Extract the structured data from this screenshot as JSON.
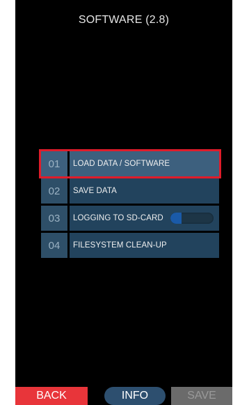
{
  "header": {
    "title": "SOFTWARE (2.8)"
  },
  "menu": {
    "items": [
      {
        "number": "01",
        "label": "LOAD DATA / SOFTWARE",
        "selected": true
      },
      {
        "number": "02",
        "label": "SAVE DATA"
      },
      {
        "number": "03",
        "label": "LOGGING TO SD-CARD",
        "toggle_level": 0.25,
        "toggle_color": "#1a5aa8"
      },
      {
        "number": "04",
        "label": "FILESYSTEM CLEAN-UP"
      }
    ]
  },
  "footer": {
    "back_label": "BACK",
    "info_label": "INFO",
    "save_label": "SAVE"
  },
  "colors": {
    "background": "#000000",
    "selection_outline": "#e01c2a",
    "back_button": "#e8353a",
    "info_button": "#2d4f6f",
    "save_button_disabled": "#6b6b6b"
  }
}
